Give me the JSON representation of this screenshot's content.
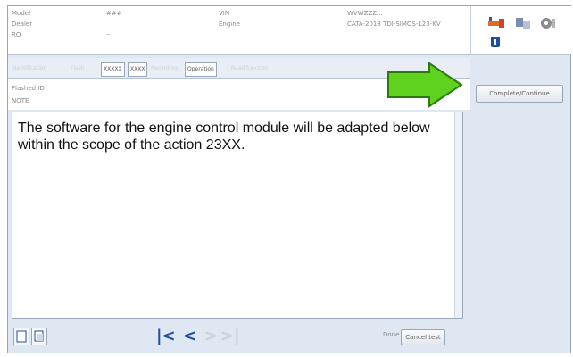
{
  "header": {
    "fields": [
      {
        "label": "Model",
        "value": "###"
      },
      {
        "label": "Dealer",
        "value": ""
      },
      {
        "label": "RO",
        "value": "--"
      }
    ],
    "mid": [
      {
        "label": "VIN",
        "value": ""
      },
      {
        "label": "",
        "value": "Engine"
      }
    ],
    "right": [
      {
        "value": "WVWZZZ..."
      },
      {
        "value": "CATA-2018 TDI-SIMOS-123-KV"
      }
    ]
  },
  "tabs": [
    {
      "label": "Identification",
      "active": false
    },
    {
      "label": "Flash",
      "active": false
    },
    {
      "label": "XXXXX",
      "active": true
    },
    {
      "label": "XXXX",
      "active": true
    },
    {
      "label": "Recording",
      "active": false
    },
    {
      "label": "Operation",
      "active": true
    },
    {
      "label": "Read function",
      "active": false
    }
  ],
  "side": {
    "complete_button": "Complete/Continue"
  },
  "info": {
    "row1": "Flashed ID",
    "row2": "NOTE"
  },
  "message": "The software for the engine control module will be adapted below within the scope of the action 23XX.",
  "bottom": {
    "done_label": "Done",
    "cancel_label": "Cancel test"
  },
  "colors": {
    "accent_arrow": "#5fd11f",
    "nav_blue": "#1e4fa0",
    "nav_grey": "#c9cfd8"
  }
}
